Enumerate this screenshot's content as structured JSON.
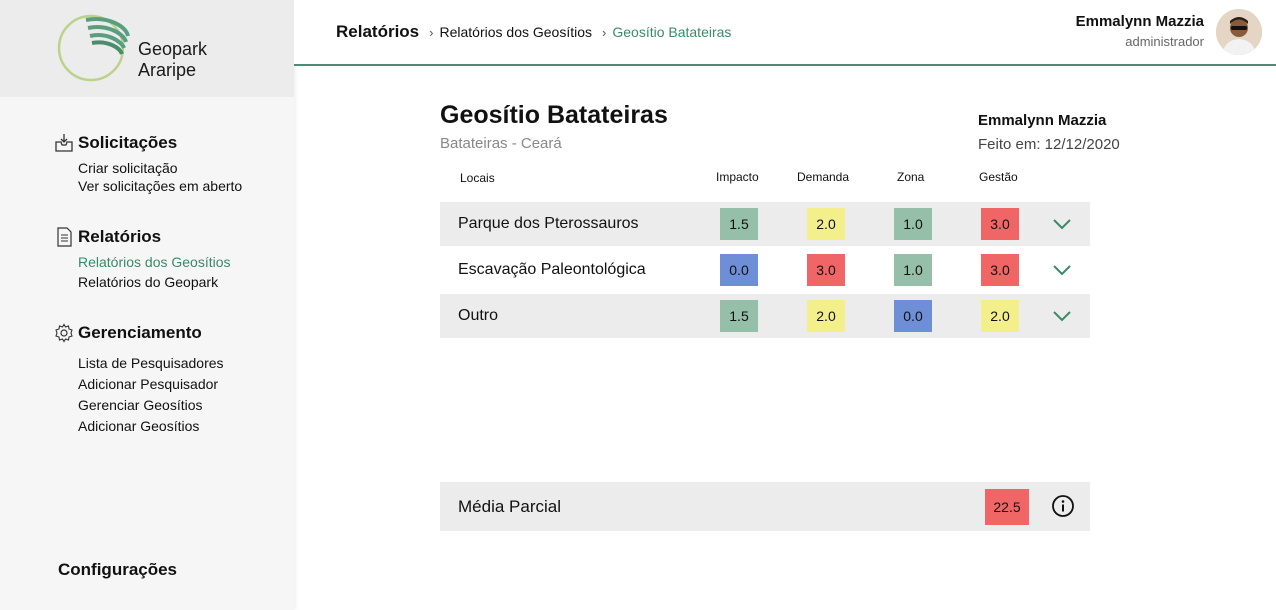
{
  "brand": {
    "line1": "Geopark",
    "line2": "Araripe"
  },
  "sidebar": {
    "sections": [
      {
        "title": "Solicitações",
        "icon": "inbox-icon",
        "items": [
          "Criar solicitação",
          "Ver solicitações em aberto"
        ]
      },
      {
        "title": "Relatórios",
        "icon": "document-icon",
        "items": [
          "Relatórios dos Geosítios",
          "Relatórios do Geopark"
        ]
      },
      {
        "title": "Gerenciamento",
        "icon": "gear-icon",
        "items": [
          "Lista de Pesquisadores",
          "Adicionar Pesquisador",
          "Gerenciar Geosítios",
          "Adicionar Geosítios"
        ]
      }
    ],
    "config": "Configurações"
  },
  "header": {
    "breadcrumb": [
      "Relatórios",
      "Relatórios dos Geosítios",
      "Geosítio Batateiras"
    ],
    "user_name": "Emmalynn Mazzia",
    "user_role": "administrador"
  },
  "report": {
    "title": "Geosítio Batateiras",
    "subtitle": "Batateiras - Ceará",
    "author": "Emmalynn Mazzia",
    "date": "Feito em: 12/12/2020",
    "columns": [
      "Locais",
      "Impacto",
      "Demanda",
      "Zona",
      "Gestão"
    ],
    "rows": [
      {
        "label": "Parque dos Pterossauros",
        "values": [
          "1.5",
          "2.0",
          "1.0",
          "3.0"
        ]
      },
      {
        "label": "Escavação Paleontológica",
        "values": [
          "0.0",
          "3.0",
          "1.0",
          "3.0"
        ]
      },
      {
        "label": "Outro",
        "values": [
          "1.5",
          "2.0",
          "0.0",
          "2.0"
        ]
      }
    ],
    "summary_label": "Média Parcial",
    "summary_value": "22.5"
  },
  "colors": {
    "green": "#95bfa9",
    "yellow": "#f3f08c",
    "red": "#f06565",
    "blue": "#6e8fd8",
    "accent": "#3a8a6a"
  }
}
